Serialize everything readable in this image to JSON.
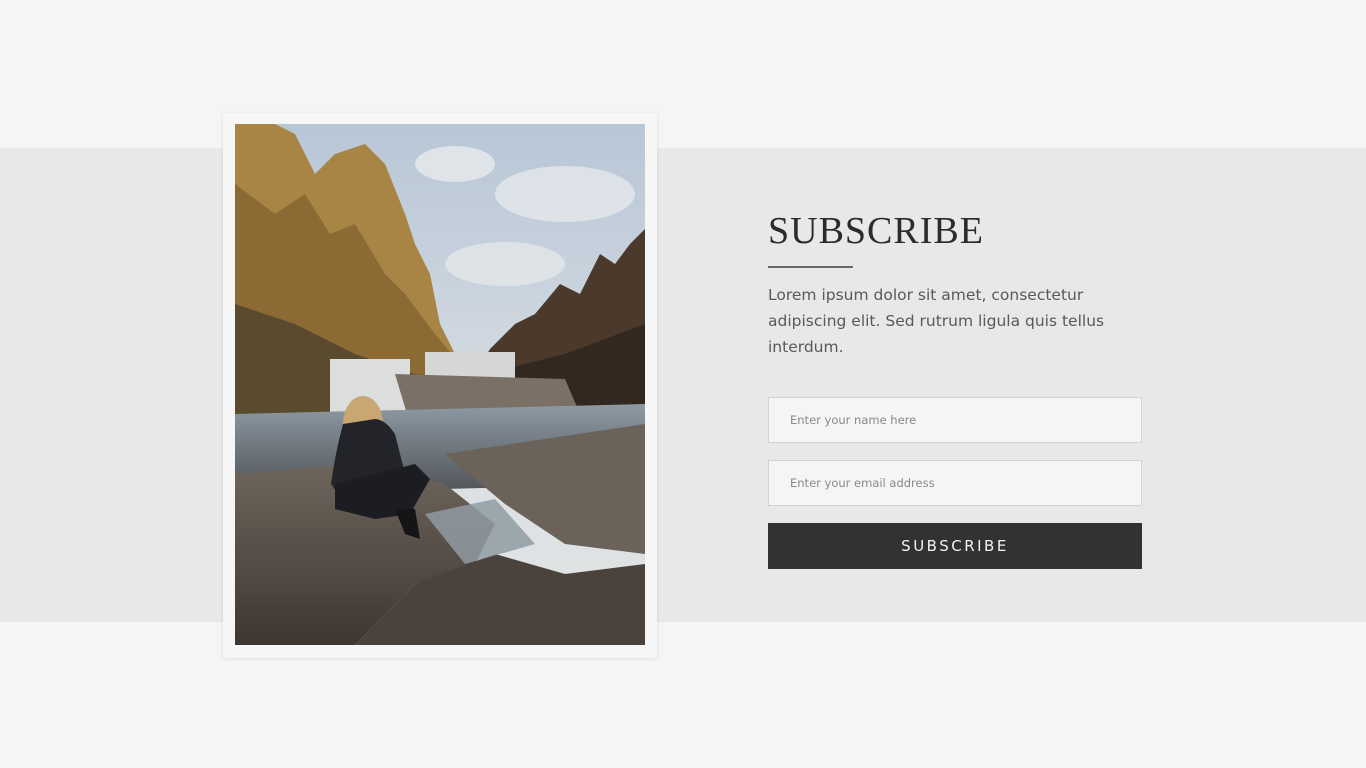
{
  "subscribe": {
    "title": "SUBSCRIBE",
    "description": "Lorem ipsum dolor sit amet, consectetur adipiscing elit. Sed rutrum ligula quis tellus interdum.",
    "name_field": {
      "value": "",
      "placeholder": "Enter your name here"
    },
    "email_field": {
      "value": "",
      "placeholder": "Enter your email address"
    },
    "button_label": "SUBSCRIBE"
  },
  "colors": {
    "page_background": "#f6f5f6",
    "band_background": "#e9e8e9",
    "button_background": "#323133",
    "title_color": "#2c2a2c"
  }
}
